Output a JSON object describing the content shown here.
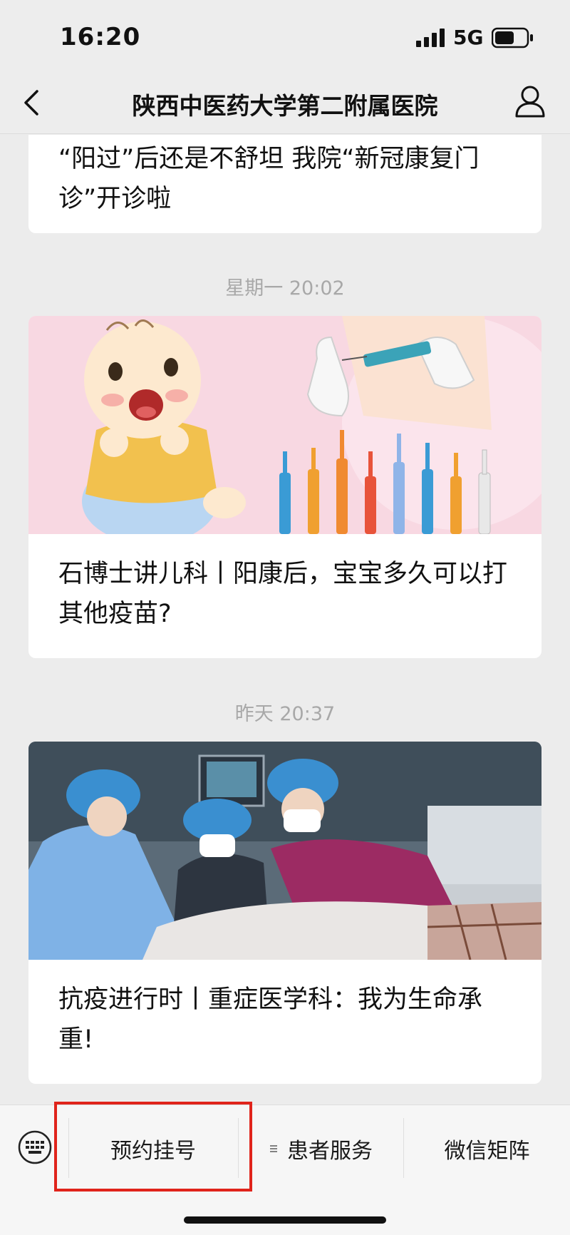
{
  "status_bar": {
    "time": "16:20",
    "network": "5G"
  },
  "nav": {
    "title": "陕西中医药大学第二附属医院"
  },
  "articles": [
    {
      "title": "“阳过”后还是不舒坦 我院“新冠康复门诊”开诊啦"
    },
    {
      "timestamp": "星期一 20:02",
      "title": "石博士讲儿科丨阳康后，宝宝多久可以打其他疫苗?"
    },
    {
      "timestamp": "昨天 20:37",
      "title": "抗疫进行时丨重症医学科：我为生命承重!"
    }
  ],
  "bottom_menu": {
    "items": [
      {
        "label": "预约挂号"
      },
      {
        "label": "患者服务"
      },
      {
        "label": "微信矩阵"
      }
    ]
  },
  "colors": {
    "highlight": "#e0241b",
    "background": "#ececec"
  }
}
